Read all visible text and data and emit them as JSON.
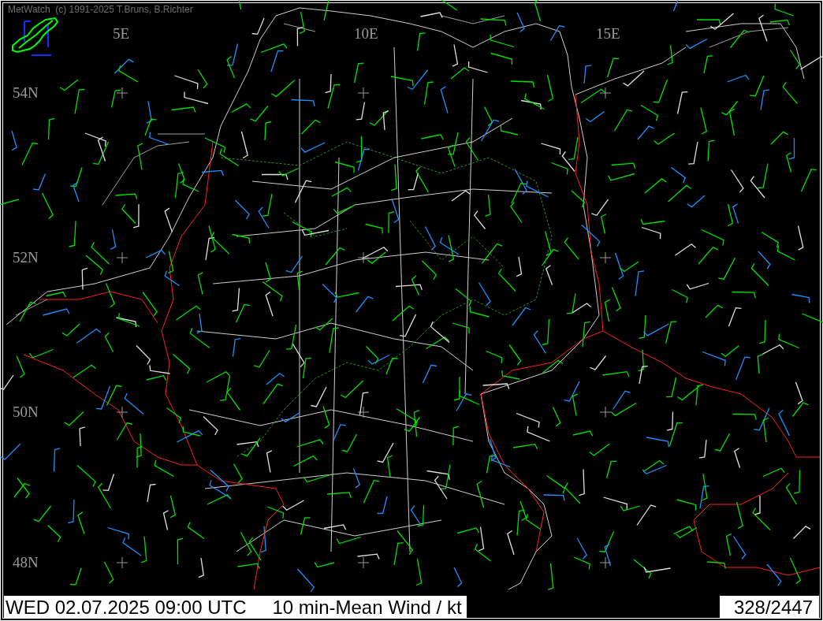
{
  "window": {
    "credit": "MetWatch  (c) 1991-2025 T.Bruns, B.Richter"
  },
  "map": {
    "longitude_labels": [
      "5E",
      "10E",
      "15E"
    ],
    "latitude_labels": [
      "54N",
      "52N",
      "50N",
      "48N"
    ]
  },
  "status_bar": {
    "datetime": "WED 02.07.2025 09:00 UTC",
    "parameter": "10 min-Mean Wind / kt",
    "count": "328/2447"
  }
}
